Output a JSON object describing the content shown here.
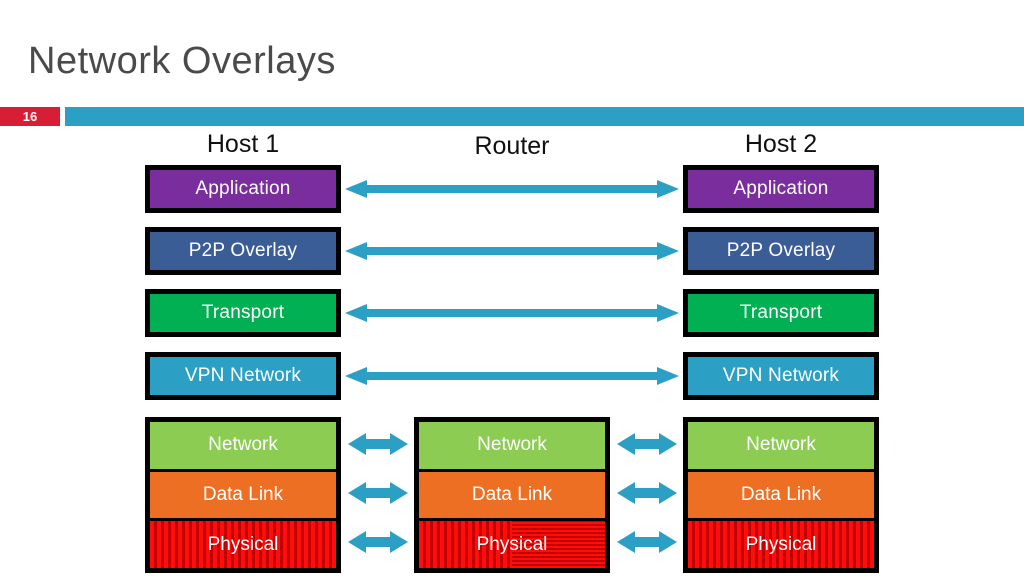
{
  "slide": {
    "title": "Network Overlays",
    "number": "16",
    "accent_color": "#2ba0c4",
    "badge_color": "#d81e35"
  },
  "diagram": {
    "columns": [
      {
        "id": "host1",
        "title": "Host 1"
      },
      {
        "id": "router",
        "title": "Router"
      },
      {
        "id": "host2",
        "title": "Host 2"
      }
    ],
    "host1": {
      "upper_layers": [
        {
          "label": "Application",
          "color": "#7a2e9d"
        },
        {
          "label": "P2P Overlay",
          "color": "#3b5d96"
        },
        {
          "label": "Transport",
          "color": "#00b052"
        },
        {
          "label": "VPN Network",
          "color": "#2ba0c4"
        }
      ],
      "lower_layers": [
        {
          "label": "Network",
          "color": "#8ccc52"
        },
        {
          "label": "Data Link",
          "color": "#ed6f23"
        },
        {
          "label": "Physical",
          "color": "#ee0000"
        }
      ]
    },
    "router": {
      "upper_layers": [],
      "lower_layers": [
        {
          "label": "Network",
          "color": "#8ccc52"
        },
        {
          "label": "Data Link",
          "color": "#ed6f23"
        },
        {
          "label": "Physical",
          "color": "#ee0000"
        }
      ]
    },
    "host2": {
      "upper_layers": [
        {
          "label": "Application",
          "color": "#7a2e9d"
        },
        {
          "label": "P2P Overlay",
          "color": "#3b5d96"
        },
        {
          "label": "Transport",
          "color": "#00b052"
        },
        {
          "label": "VPN Network",
          "color": "#2ba0c4"
        }
      ],
      "lower_layers": [
        {
          "label": "Network",
          "color": "#8ccc52"
        },
        {
          "label": "Data Link",
          "color": "#ed6f23"
        },
        {
          "label": "Physical",
          "color": "#ee0000"
        }
      ]
    },
    "arrows": {
      "color": "#2ba0c4",
      "long_peer_links": [
        {
          "layer": "Application",
          "from": "host1",
          "to": "host2",
          "bidirectional": true
        },
        {
          "layer": "P2P Overlay",
          "from": "host1",
          "to": "host2",
          "bidirectional": true
        },
        {
          "layer": "Transport",
          "from": "host1",
          "to": "host2",
          "bidirectional": true
        },
        {
          "layer": "VPN Network",
          "from": "host1",
          "to": "host2",
          "bidirectional": true
        }
      ],
      "short_hop_links": [
        {
          "layer": "Network",
          "from": "host1",
          "to": "router",
          "bidirectional": true
        },
        {
          "layer": "Data Link",
          "from": "host1",
          "to": "router",
          "bidirectional": true
        },
        {
          "layer": "Physical",
          "from": "host1",
          "to": "router",
          "bidirectional": true
        },
        {
          "layer": "Network",
          "from": "router",
          "to": "host2",
          "bidirectional": true
        },
        {
          "layer": "Data Link",
          "from": "router",
          "to": "host2",
          "bidirectional": true
        },
        {
          "layer": "Physical",
          "from": "router",
          "to": "host2",
          "bidirectional": true
        }
      ]
    }
  }
}
